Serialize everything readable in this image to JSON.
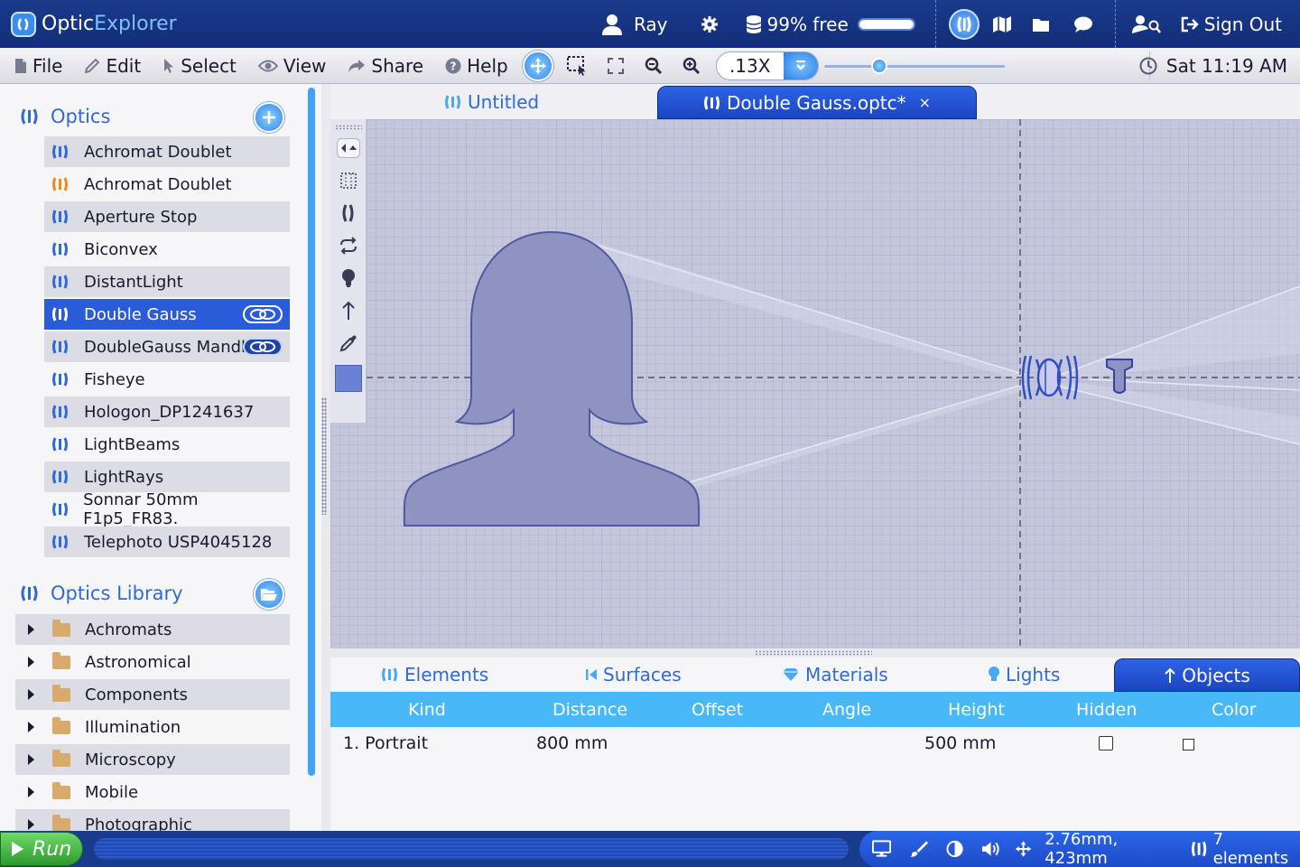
{
  "app": {
    "brand_part1": "Optic",
    "brand_part2": "Explorer",
    "user": "Ray",
    "storage_label": "99% free",
    "storage_free_fraction": 0.99,
    "sign_out": "Sign Out"
  },
  "menu": {
    "file": "File",
    "edit": "Edit",
    "select": "Select",
    "view": "View",
    "share": "Share",
    "help": "Help",
    "zoom_value": ".13X",
    "clock": "Sat 11:19 AM"
  },
  "sidebar": {
    "optics_title": "Optics",
    "optics": [
      {
        "label": "Achromat Doublet"
      },
      {
        "label": "Achromat Doublet"
      },
      {
        "label": "Aperture Stop"
      },
      {
        "label": "Biconvex"
      },
      {
        "label": "DistantLight"
      },
      {
        "label": "Double Gauss"
      },
      {
        "label": "DoubleGauss Mandl."
      },
      {
        "label": "Fisheye"
      },
      {
        "label": "Hologon_DP1241637"
      },
      {
        "label": "LightBeams"
      },
      {
        "label": "LightRays"
      },
      {
        "label": "Sonnar 50mm F1p5_FR83."
      },
      {
        "label": "Telephoto USP4045128"
      }
    ],
    "library_title": "Optics Library",
    "library": [
      {
        "label": "Achromats"
      },
      {
        "label": "Astronomical"
      },
      {
        "label": "Components"
      },
      {
        "label": "Illumination"
      },
      {
        "label": "Microscopy"
      },
      {
        "label": "Mobile"
      },
      {
        "label": "Photographic"
      }
    ]
  },
  "tabs": {
    "untitled": "Untitled",
    "active": "Double Gauss.optc*",
    "close": "×"
  },
  "panel": {
    "tabs": {
      "elements": "Elements",
      "surfaces": "Surfaces",
      "materials": "Materials",
      "lights": "Lights",
      "objects": "Objects"
    },
    "columns": {
      "kind": "Kind",
      "distance": "Distance",
      "offset": "Offset",
      "angle": "Angle",
      "height": "Height",
      "hidden": "Hidden",
      "color": "Color"
    },
    "rows": [
      {
        "kind": "1. Portrait",
        "distance": "800 mm",
        "offset": "",
        "angle": "",
        "height": "500 mm",
        "hidden": false
      }
    ]
  },
  "status": {
    "run": "Run",
    "coords": "2.76mm, 423mm",
    "elements": "7 elements"
  },
  "colors": {
    "brand_blue": "#1a3a8c",
    "accent": "#2f6ad8",
    "selected_row": "#2a5cd9",
    "table_header": "#49b8f8",
    "canvas": "#c4c6dc",
    "object_fill": "#8f93c2",
    "run_green": "#3fb33f"
  },
  "icons": {
    "optic_item": "lens-icon",
    "optic_item_alt": "lens-orange-icon",
    "library_item": "folder-icon"
  }
}
